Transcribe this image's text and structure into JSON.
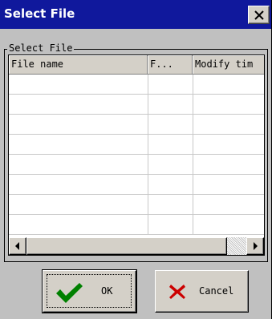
{
  "dialog": {
    "title": "Select File",
    "close_icon": "close-x-icon"
  },
  "group": {
    "label": "Select File"
  },
  "list": {
    "columns": [
      "File name",
      "F...",
      "Modify tim"
    ],
    "rows": []
  },
  "scrollbar": {
    "left_icon": "arrow-left-icon",
    "right_icon": "arrow-right-icon"
  },
  "buttons": {
    "ok_label": "OK",
    "ok_icon": "checkmark-icon",
    "cancel_label": "Cancel",
    "cancel_icon": "red-x-icon"
  },
  "colors": {
    "titlebar": "#10189c",
    "face": "#c0c0c0",
    "check": "#008000",
    "cancel_x": "#cc0000"
  }
}
